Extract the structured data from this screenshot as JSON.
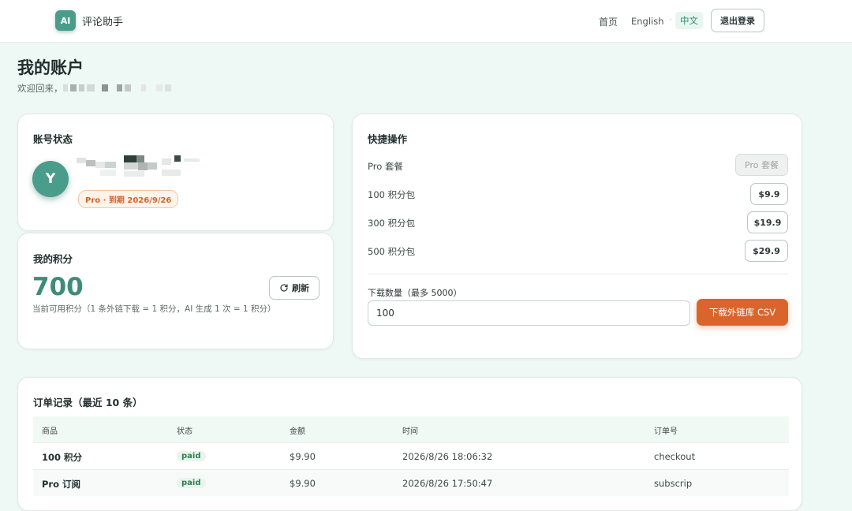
{
  "header": {
    "logo_text": "AI",
    "brand": "评论助手",
    "nav": {
      "home": "首页",
      "english": "English",
      "separator": "·",
      "chinese": "中文"
    },
    "logout_label": "退出登录"
  },
  "page": {
    "title": "我的账户",
    "welcome": "欢迎回来，"
  },
  "account_card": {
    "title": "账号状态",
    "avatar_letter": "Y",
    "plan_badge": "Pro · 到期 2026/9/26"
  },
  "points_card": {
    "title": "我的积分",
    "value": "700",
    "description": "当前可用积分（1 条外链下载 = 1 积分，AI 生成 1 次 = 1 积分）",
    "refresh_label": "刷新"
  },
  "quick_actions": {
    "title": "快捷操作",
    "items": [
      {
        "label": "Pro 套餐",
        "button": "Pro 套餐",
        "disabled": true
      },
      {
        "label": "100 积分包",
        "button": "$9.9",
        "disabled": false
      },
      {
        "label": "300 积分包",
        "button": "$19.9",
        "disabled": false
      },
      {
        "label": "500 积分包",
        "button": "$29.9",
        "disabled": false
      }
    ],
    "download_label": "下载数量（最多 5000）",
    "download_value": "100",
    "download_button": "下载外链库 CSV"
  },
  "orders": {
    "title": "订单记录（最近 10 条）",
    "columns": [
      "商品",
      "状态",
      "金额",
      "时间",
      "订单号"
    ],
    "rows": [
      {
        "product": "100 积分",
        "status": "paid",
        "amount": "$9.90",
        "time": "2026/8/26 18:06:32",
        "order_id": "checkout"
      },
      {
        "product": "Pro 订阅",
        "status": "paid",
        "amount": "$9.90",
        "time": "2026/8/26 17:50:47",
        "order_id": "subscrip"
      }
    ]
  },
  "colors": {
    "accent": "#4a9d8a",
    "orange": "#d9652c",
    "background": "#eef8f4"
  }
}
